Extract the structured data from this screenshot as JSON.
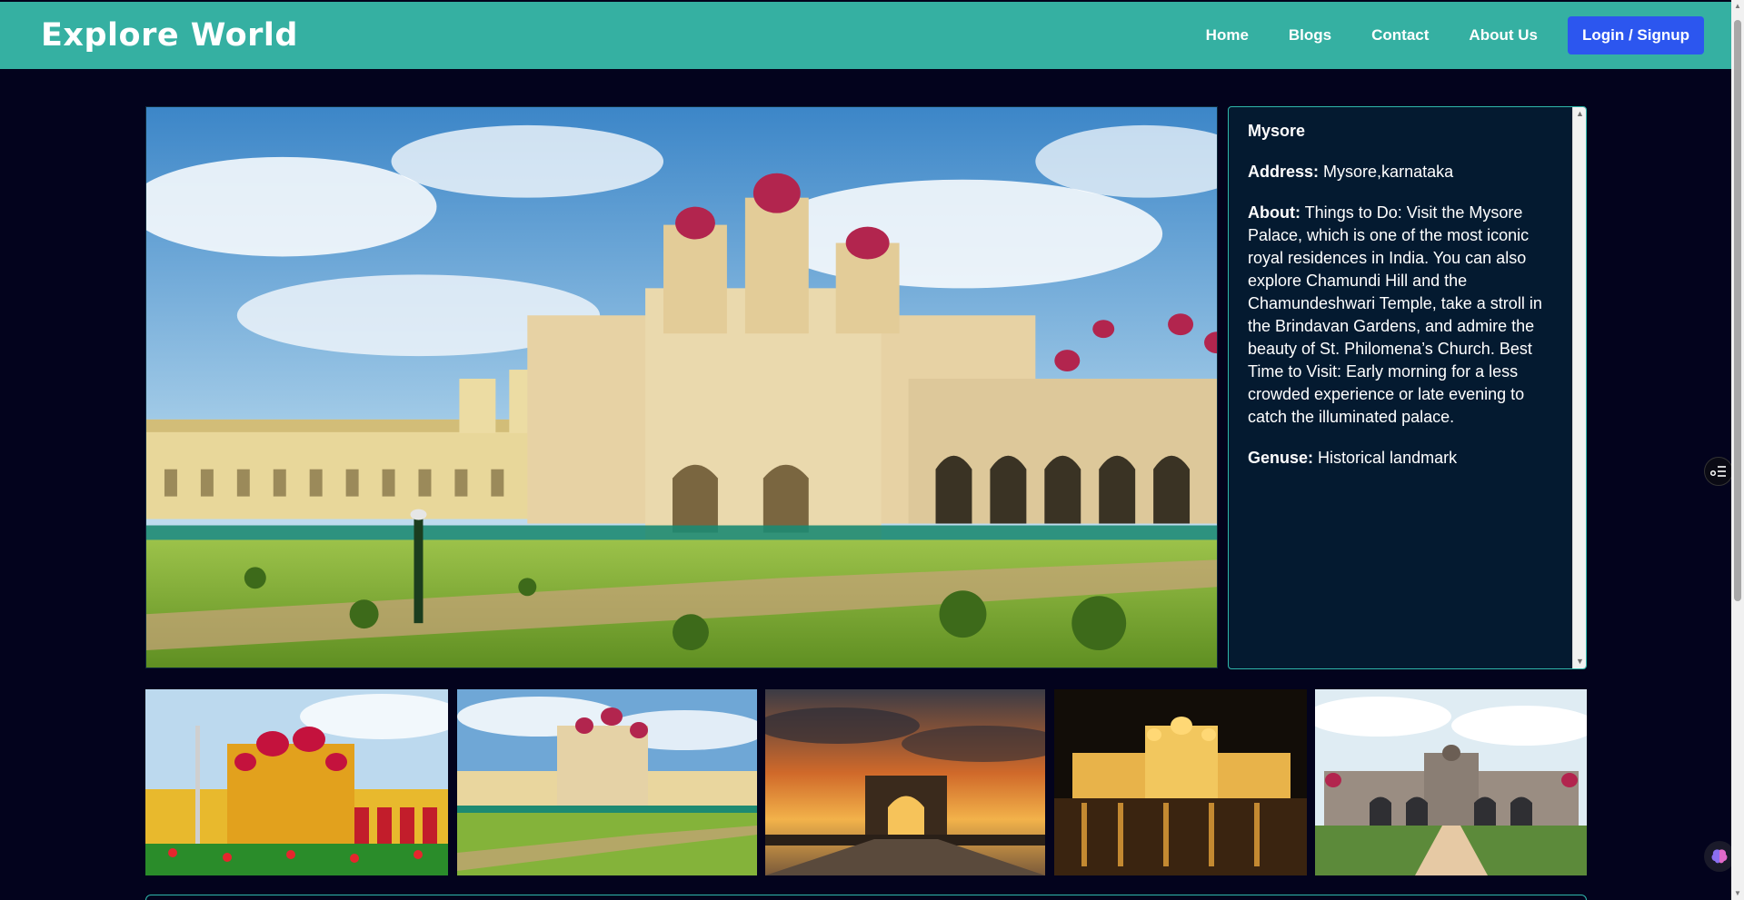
{
  "navbar": {
    "brand": "Explore World",
    "links": [
      "Home",
      "Blogs",
      "Contact",
      "About Us"
    ],
    "login_label": "Login / Signup"
  },
  "place": {
    "title": "Mysore",
    "address_label": "Address:",
    "address": "Mysore,karnataka",
    "about_label": "About:",
    "about": "Things to Do: Visit the Mysore Palace, which is one of the most iconic royal residences in India. You can also explore Chamundi Hill and the Chamundeshwari Temple, take a stroll in the Brindavan Gardens, and admire the beauty of St. Philomena’s Church. Best Time to Visit: Early morning for a less crowded experience or late evening to catch the illuminated palace.",
    "genre_label": "Genuse:",
    "genre": "Historical landmark"
  },
  "images": {
    "hero": "mysore-palace-garden-photo",
    "thumbnails": [
      "palace-colorful-front-photo",
      "palace-garden-photo",
      "palace-gate-sunset-photo",
      "palace-illuminated-night-photo",
      "palace-front-avenue-photo"
    ]
  },
  "colors": {
    "navbar": "#35b0a2",
    "background": "#03031d",
    "panel": "#041a30",
    "accent_border": "#2fb7ab",
    "login_button": "#2c56ef"
  },
  "icons": {
    "side_toggle": "list-settings-icon",
    "assistant": "brain-icon"
  }
}
